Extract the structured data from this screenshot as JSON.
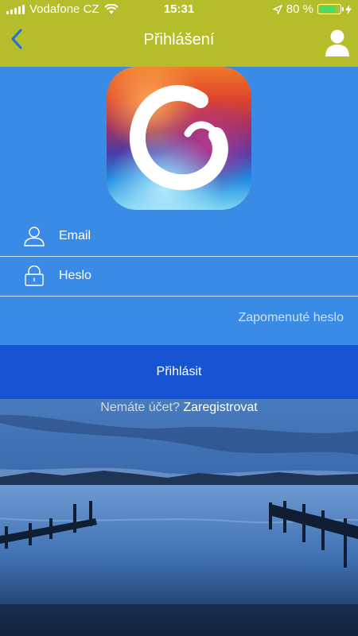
{
  "status_bar": {
    "carrier": "Vodafone CZ",
    "time": "15:31",
    "battery": "80 %",
    "battery_level": 0.8,
    "icons": [
      "signal-icon",
      "wifi-icon",
      "location-arrow-icon",
      "battery-icon",
      "charging-icon"
    ]
  },
  "nav": {
    "title": "Přihlášení",
    "back_icon": "chevron-left-icon",
    "profile_icon": "user-icon"
  },
  "form": {
    "email_placeholder": "Email",
    "password_placeholder": "Heslo",
    "email_value": "",
    "password_value": "",
    "forgot_password": "Zapomenuté heslo",
    "login_button": "Přihlásit"
  },
  "register": {
    "prompt": "Nemáte účet?",
    "link": "Zaregistrovat"
  },
  "colors": {
    "header": "#b5bd2a",
    "background": "#3a8be6",
    "button": "#1754d3",
    "back_icon": "#1f6fe0"
  }
}
